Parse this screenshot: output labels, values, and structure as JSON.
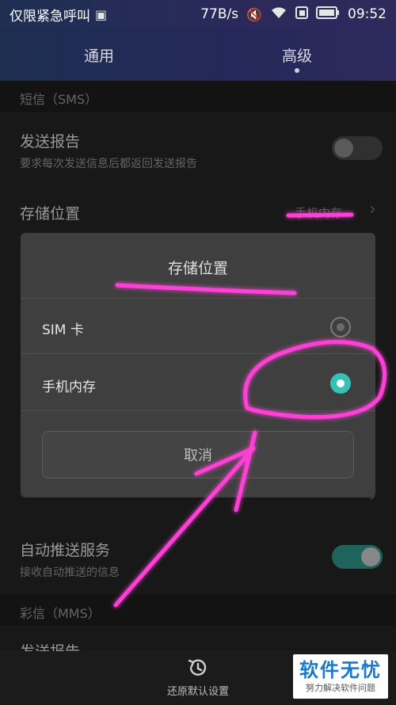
{
  "statusbar": {
    "carrier": "仅限紧急呼叫",
    "speed": "77B/s",
    "time": "09:52"
  },
  "tabs": [
    {
      "label": "通用"
    },
    {
      "label": "高级"
    }
  ],
  "sms_section": {
    "header": "短信（SMS）",
    "delivery_report": {
      "title": "发送报告",
      "subtitle": "要求每次发送信息后都返回发送报告",
      "enabled": false
    },
    "storage": {
      "title": "存储位置",
      "value": "手机内存"
    },
    "auto_push": {
      "title": "自动推送服务",
      "subtitle": "接收自动推送的信息",
      "enabled": true
    }
  },
  "mms_section": {
    "header": "彩信（MMS）",
    "delivery_report": {
      "title": "发送报告"
    }
  },
  "dialog": {
    "title": "存储位置",
    "options": [
      {
        "label": "SIM 卡",
        "selected": false
      },
      {
        "label": "手机内存",
        "selected": true
      }
    ],
    "cancel_label": "取消"
  },
  "bottombar": {
    "restore_label": "还原默认设置"
  },
  "watermark": {
    "main": "软件无忧",
    "sub": "努力解决软件问题"
  },
  "colors": {
    "accent": "#35c1b6",
    "toggle_on": "#2e9a8e",
    "annotation": "#ff3fd6"
  }
}
